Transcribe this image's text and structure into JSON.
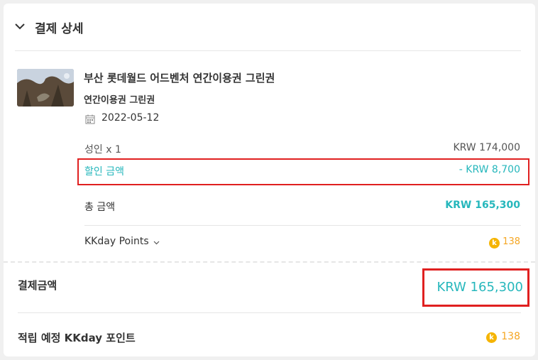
{
  "header": {
    "title": "결제 상세",
    "chevron_icon": "chevron-down-icon"
  },
  "product": {
    "title": "부산 롯데월드 어드벤처 연간이용권 그린권",
    "subtitle": "연간이용권 그린권",
    "date": "2022-05-12",
    "date_icon": "calendar-icon",
    "thumbnail": "product-thumbnail"
  },
  "price": {
    "adult_label": "성인 x 1",
    "adult_value": "KRW 174,000",
    "discount_label": "할인 금액",
    "discount_value": "- KRW 8,700",
    "total_label": "총 금액",
    "total_value": "KRW 165,300"
  },
  "points": {
    "label": "KKday Points",
    "coin_letter": "k",
    "value": "138"
  },
  "payment": {
    "label": "결제금액",
    "value": "KRW 165,300"
  },
  "earn": {
    "label": "적립 예정 KKday 포인트",
    "value": "138"
  },
  "colors": {
    "accent": "#26b7bc",
    "highlight_box": "#e02020",
    "points": "#f5a623",
    "coin": "#f5b400"
  }
}
